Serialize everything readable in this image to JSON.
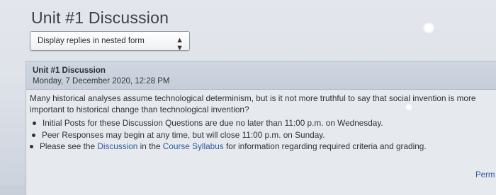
{
  "forum": {
    "title": "Unit #1 Discussion"
  },
  "display_select": {
    "selected": "Display replies in nested form",
    "icon": "select-arrows-icon"
  },
  "post": {
    "subject": "Unit #1 Discussion",
    "date": "Monday, 7 December 2020, 12:28 PM",
    "question_line1": "Many historical analyses assume technological determinism, but is it not more truthful to say that social invention is more",
    "question_line2": "important to historical change than technological invention?",
    "bullets": [
      {
        "text": "Initial Posts for these Discussion Questions are due no later than 11:00 p.m. on Wednesday."
      },
      {
        "text": "Peer Responses may begin at any time, but will close 11:00 p.m. on Sunday."
      },
      {
        "text_before": "Please see the ",
        "link1": "Discussion",
        "text_middle": " in the ",
        "link2": "Course Syllabus",
        "text_after": " for information regarding required criteria and grading."
      }
    ],
    "permalink": "Perm"
  },
  "colors": {
    "link": "#2f5aa0",
    "header_bg": "#c6ceda",
    "page_bg": "#e3e6ec"
  }
}
